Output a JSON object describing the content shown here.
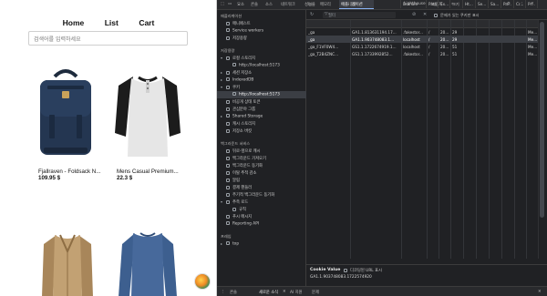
{
  "webpage": {
    "nav": [
      "Home",
      "List",
      "Cart"
    ],
    "search_placeholder": "검색어를 입력하세요",
    "products": [
      {
        "title": "Fjallraven - Foldsack N...",
        "price": "109.95 $"
      },
      {
        "title": "Mens Casual Premium...",
        "price": "22.3 $"
      },
      {
        "title": "",
        "price": ""
      },
      {
        "title": "",
        "price": ""
      }
    ]
  },
  "devtools": {
    "tabs": [
      "요소",
      "콘솔",
      "소스",
      "네트워크",
      "성능",
      "메모리",
      "애플리케이션",
      "Lighthouse",
      "녹음기"
    ],
    "active_tab": "애플리케이션",
    "sidebar": {
      "app_header": "애플리케이션",
      "app_items": [
        "매니페스트",
        "Service workers",
        "저장용량"
      ],
      "storage_header": "저장용량",
      "local_storage": "로컬 스토리지",
      "local_storage_url": "http://localhost:5173",
      "session_storage": "세션 저장소",
      "indexeddb": "IndexedDB",
      "cookies": "쿠키",
      "cookies_url": "http://localhost:5173",
      "private_tokens": "비공개 상태 토큰",
      "interest_groups": "관심분야 그룹",
      "shared_storage": "Shared Storage",
      "cache_storage": "캐시 스토리지",
      "storage_buckets": "저장소 버킷",
      "bg_header": "백그라운드 서비스",
      "bg_items": [
        "뒤로-앞으로 캐시",
        "백그라운드 가져오기",
        "백그라운드 동기화",
        "이탈 추적 감소",
        "알림",
        "결제 핸들러",
        "주기적 백그라운드 동기화",
        "추측 로드",
        "푸시 메시지",
        "Reporting API"
      ],
      "speculative_sub": "규칙",
      "frames_header": "프레임",
      "frames_top": "top"
    },
    "toolbar": {
      "filter_placeholder": "필터",
      "issue_cookies_label": "문제가 있는 쿠키만 표시"
    },
    "columns": [
      "이름",
      "값",
      "Domain",
      "Path",
      "Ex...",
      "크기",
      "Ht...",
      "Se...",
      "Sa...",
      "Pa...",
      "Cr...",
      "Pr..."
    ],
    "rows": [
      [
        "_ga",
        "GA1.1.813631194.17...",
        ".fakestor...",
        "/",
        "20...",
        "29",
        "",
        "",
        "",
        "",
        "",
        "Me..."
      ],
      [
        "_ga",
        "GA1.1.903748083.1...",
        "localhost",
        "/",
        "20...",
        "29",
        "",
        "",
        "",
        "",
        "",
        "Me..."
      ],
      [
        "_ga_F1VF0W4...",
        "GS1.1.1722674919.1...",
        "localhost",
        "/",
        "20...",
        "51",
        "",
        "",
        "",
        "",
        "",
        "Me..."
      ],
      [
        "_ga_T2B4ZNC...",
        "GS1.1.1733992852...",
        ".fakestor...",
        "/",
        "20...",
        "51",
        "",
        "",
        "",
        "",
        "",
        "Me..."
      ]
    ],
    "cookie_value_label": "Cookie Value",
    "decode_label": "디코딩된 URL 표시",
    "cookie_value": "GA1.1.903748083.1722574920",
    "drawer_tabs": [
      "콘솔",
      "새로운 소식",
      "AI 지원",
      "문제"
    ]
  }
}
